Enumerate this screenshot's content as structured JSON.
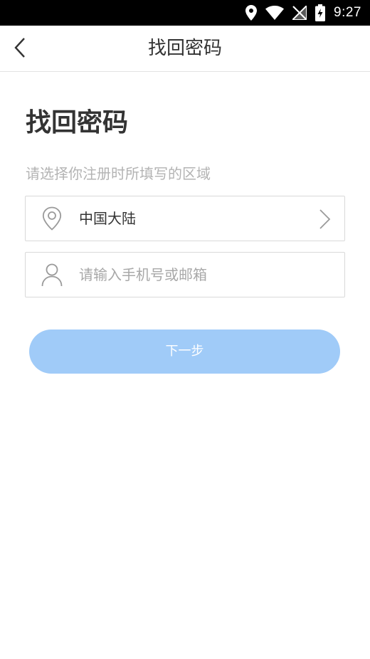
{
  "status_bar": {
    "time": "9:27",
    "icons": [
      "location-icon",
      "wifi-icon",
      "no-signal-icon",
      "battery-charging-icon"
    ]
  },
  "navbar": {
    "title": "找回密码",
    "back_icon": "chevron-left-icon"
  },
  "main": {
    "heading": "找回密码",
    "hint": "请选择你注册时所填写的区域",
    "region_field": {
      "icon": "location-pin-icon",
      "value": "中国大陆",
      "chevron_icon": "chevron-right-icon"
    },
    "account_field": {
      "icon": "user-icon",
      "value": "",
      "placeholder": "请输入手机号或邮箱"
    },
    "next_button": {
      "label": "下一步",
      "color": "#a0cbf8"
    }
  }
}
